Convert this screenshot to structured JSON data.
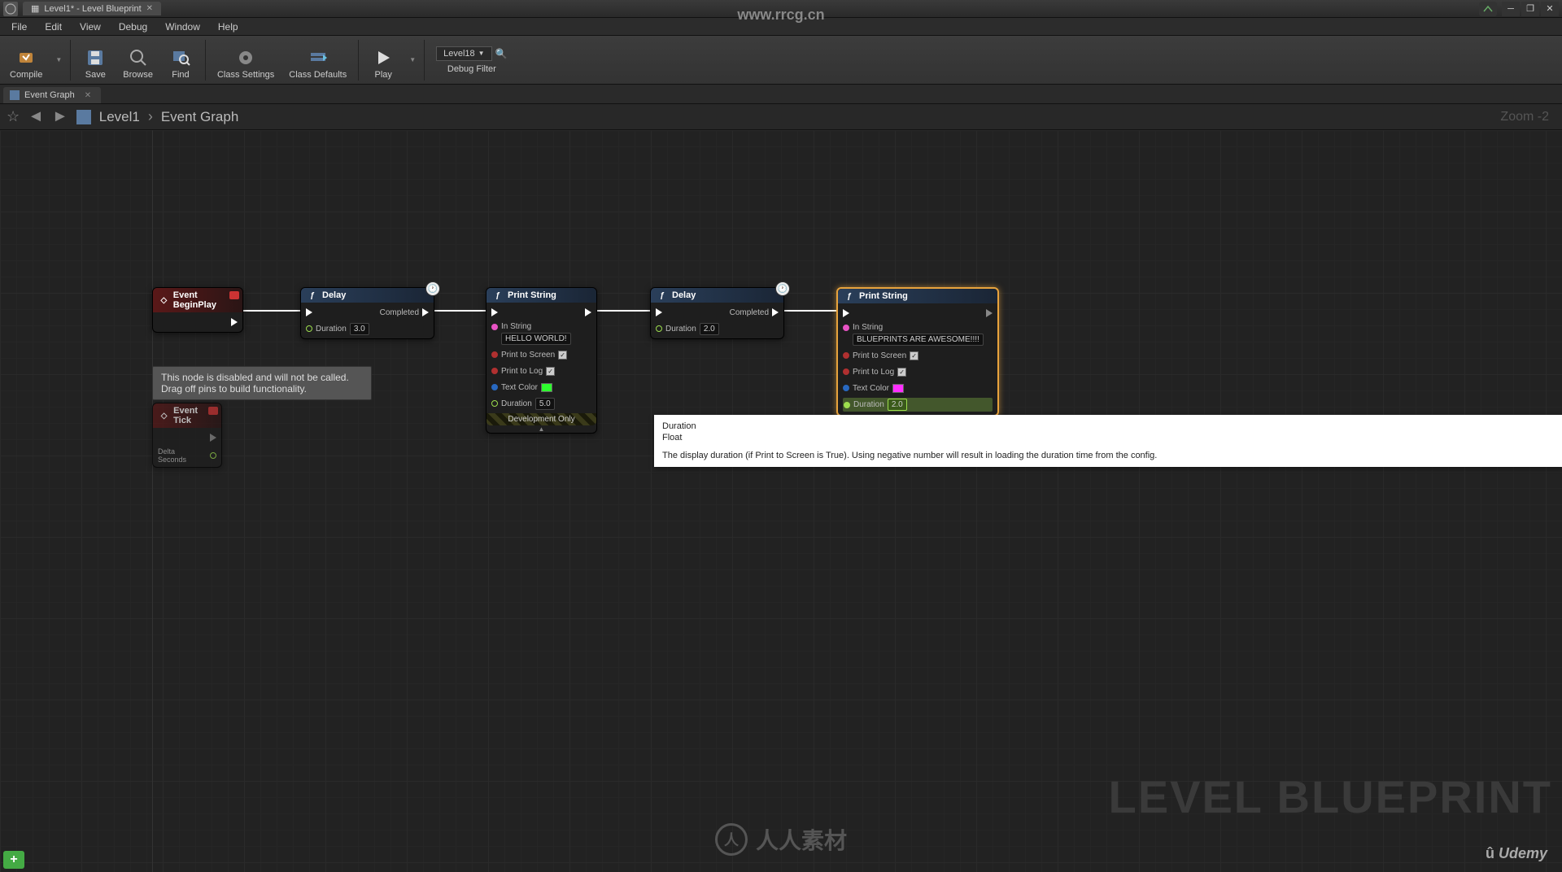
{
  "window": {
    "title": "Level1* - Level Blueprint",
    "url_watermark": "www.rrcg.cn"
  },
  "menu": {
    "file": "File",
    "edit": "Edit",
    "view": "View",
    "debug": "Debug",
    "window": "Window",
    "help": "Help"
  },
  "toolbar": {
    "compile": "Compile",
    "save": "Save",
    "browse": "Browse",
    "find": "Find",
    "class_settings": "Class Settings",
    "class_defaults": "Class Defaults",
    "play": "Play",
    "debug_filter_label": "Debug Filter",
    "debug_filter_value": "Level18"
  },
  "tabs": {
    "event_graph": "Event Graph"
  },
  "breadcrumb": {
    "level": "Level1",
    "graph": "Event Graph",
    "zoom": "Zoom -2"
  },
  "nodes": {
    "begin_play": {
      "title": "Event BeginPlay"
    },
    "delay1": {
      "title": "Delay",
      "completed": "Completed",
      "duration_label": "Duration",
      "duration_value": "3.0"
    },
    "print1": {
      "title": "Print String",
      "in_string_label": "In String",
      "in_string_value": "HELLO WORLD!",
      "print_screen": "Print to Screen",
      "print_log": "Print to Log",
      "text_color": "Text Color",
      "duration_label": "Duration",
      "duration_value": "5.0",
      "dev_only": "Development Only"
    },
    "delay2": {
      "title": "Delay",
      "completed": "Completed",
      "duration_label": "Duration",
      "duration_value": "2.0"
    },
    "print2": {
      "title": "Print String",
      "in_string_label": "In String",
      "in_string_value": "BLUEPRINTS ARE AWESOME!!!!",
      "print_screen": "Print to Screen",
      "print_log": "Print to Log",
      "text_color": "Text Color",
      "duration_label": "Duration",
      "duration_value": "2.0"
    },
    "tick": {
      "title": "Event Tick",
      "delta": "Delta Seconds"
    },
    "disabled_comment": "This node is disabled and will not be called.\nDrag off pins to build functionality."
  },
  "tooltip": {
    "title": "Duration",
    "type": "Float",
    "desc": "The display duration (if Print to Screen is True). Using negative number will result in loading the duration time from the config."
  },
  "watermarks": {
    "big": "LEVEL BLUEPRINT",
    "udemy": "Udemy",
    "source": "人人素材"
  }
}
